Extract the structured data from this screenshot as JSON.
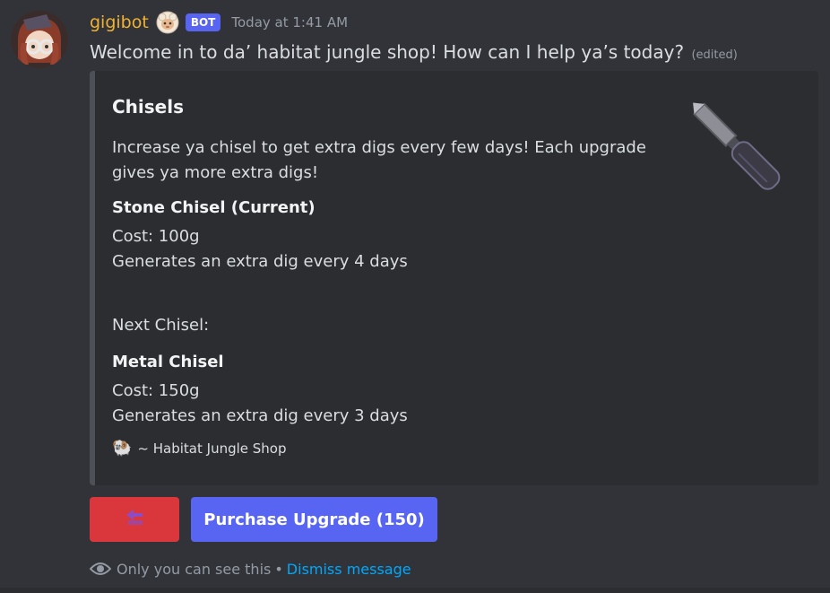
{
  "message": {
    "author": "gigibot",
    "bot_tag": "BOT",
    "timestamp": "Today at 1:41 AM",
    "text": "Welcome in to da’ habitat jungle shop! How can I help ya’s today?",
    "edited_label": "(edited)",
    "badge_icon": "sheep-icon",
    "avatar_icon": "avatar-image"
  },
  "embed": {
    "title": "Chisels",
    "description": "Increase ya chisel to get extra digs every few days! Each upgrade gives ya more extra digs!",
    "current": {
      "name": "Stone Chisel (Current)",
      "cost": "Cost: 100g",
      "generates": "Generates an extra dig every 4 days"
    },
    "next_label": "Next Chisel:",
    "next": {
      "name": "Metal Chisel",
      "cost": "Cost: 150g",
      "generates": "Generates an extra dig every 3 days"
    },
    "footer_text": "~ Habitat Jungle Shop",
    "footer_icon": "ram-icon",
    "thumbnail_icon": "chisel-icon",
    "accent_color": "#4e5058"
  },
  "buttons": {
    "back_icon": "back-arrow-icon",
    "purchase_label": "Purchase Upgrade (150)"
  },
  "ephemeral": {
    "notice": "Only you can see this",
    "separator": "•",
    "dismiss_label": "Dismiss message"
  },
  "colors": {
    "username": "#f0b232",
    "bot_tag": "#5865f2",
    "danger_button": "#da373c",
    "primary_button": "#5865f2",
    "link": "#00a8fc"
  }
}
